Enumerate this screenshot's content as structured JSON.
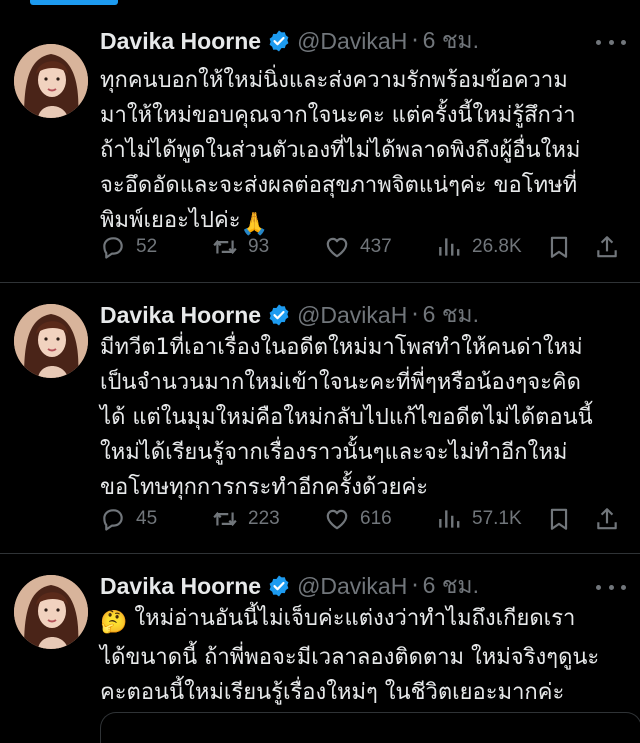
{
  "tweets": [
    {
      "name": "Davika Hoorne",
      "handle": "@DavikaH",
      "sep": "·",
      "time": "6 ชม.",
      "lines": [
        "ทุกคนบอกให้ใหม่นิ่งและส่งความรักพร้อมข้อความ",
        "มาให้ใหม่ขอบคุณจากใจนะคะ แต่ครั้งนี้ใหม่รู้สึกว่า",
        "ถ้าไม่ได้พูดในส่วนตัวเองที่ไม่ได้พลาดพิงถึงผู้อื่นใหม่",
        "จะอึดอัดและจะส่งผลต่อสุขภาพจิตแน่ๆค่ะ ขอโทษที่",
        "พิมพ์เยอะไปค่ะ"
      ],
      "line_emoji": "🙏",
      "replies": "52",
      "retweets": "93",
      "likes": "437",
      "views": "26.8K"
    },
    {
      "name": "Davika Hoorne",
      "handle": "@DavikaH",
      "sep": "·",
      "time": "6 ชม.",
      "lines": [
        "มีทวีต1ที่เอาเรื่องในอดีตใหม่มาโพสทำให้คนด่าใหม่",
        "เป็นจำนวนมากใหม่เข้าใจนะคะที่พี่ๆหรือน้องๆจะคิด",
        "ได้ แต่ในมุมใหม่คือใหม่กลับไปแก้ไขอดีตไม่ได้ตอนนี้",
        "ใหม่ได้เรียนรู้จากเรื่องราวนั้นๆและจะไม่ทำอีกใหม่",
        "ขอโทษทุกการกระทำอีกครั้งด้วยค่ะ"
      ],
      "replies": "45",
      "retweets": "223",
      "likes": "616",
      "views": "57.1K"
    },
    {
      "name": "Davika Hoorne",
      "handle": "@DavikaH",
      "sep": "·",
      "time": "6 ชม.",
      "lead_emoji": "🤔",
      "lines": [
        "ใหม่อ่านอันนี้ไม่เจ็บค่ะแต่งงว่าทำไมถึงเกียดเรา",
        "ได้ขนาดนี้ ถ้าพี่พอจะมีเวลาลองติดตาม ใหม่จริงๆดูนะ",
        "คะตอนนี้ใหม่เรียนรู้เรื่องใหม่ๆ ในชีวิตเยอะมากค่ะ"
      ]
    }
  ],
  "icons": {
    "verified": "verified-badge-icon",
    "reply": "reply-icon",
    "retweet": "retweet-icon",
    "like": "like-icon",
    "views": "views-icon",
    "bookmark": "bookmark-icon",
    "share": "share-icon",
    "more": "more-icon"
  },
  "colors": {
    "background": "#000000",
    "text": "#e7e9ea",
    "secondary": "#71767b",
    "verified": "#1d9bf0",
    "divider": "#2f3336"
  }
}
